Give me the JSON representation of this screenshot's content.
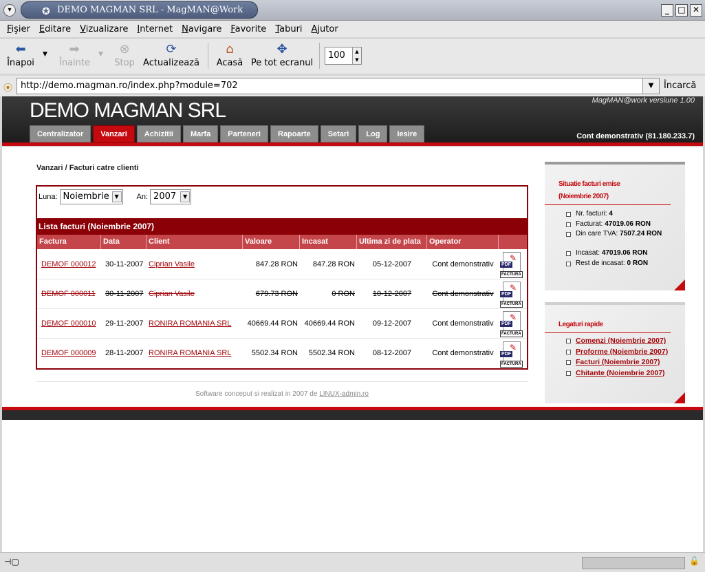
{
  "window": {
    "title": "DEMO MAGMAN SRL - MagMAN@Work"
  },
  "menu": [
    "Fişier",
    "Editare",
    "Vizualizare",
    "Internet",
    "Navigare",
    "Favorite",
    "Taburi",
    "Ajutor"
  ],
  "toolbar": {
    "back": "Înapoi",
    "forward": "Înainte",
    "stop": "Stop",
    "reload": "Actualizează",
    "home": "Acasă",
    "fullscreen": "Pe tot ecranul",
    "zoom": "100"
  },
  "address": {
    "url": "http://demo.magman.ro/index.php?module=702",
    "go": "Încarcă"
  },
  "header": {
    "logo": "DEMO MAGMAN SRL",
    "version": "MagMAN@work versiune 1.00",
    "account": "Cont demonstrativ (81.180.233.7)"
  },
  "tabs": [
    "Centralizator",
    "Vanzari",
    "Achizitii",
    "Marfa",
    "Parteneri",
    "Rapoarte",
    "Setari",
    "Log",
    "Iesire"
  ],
  "active_tab": "Vanzari",
  "breadcrumb": "Vanzari / Facturi catre clienti",
  "filters": {
    "month_label": "Luna:",
    "month_value": "Noiembrie",
    "year_label": "An:",
    "year_value": "2007"
  },
  "list": {
    "title": "Lista facturi (Noiembrie 2007)",
    "columns": [
      "Factura",
      "Data",
      "Client",
      "Valoare",
      "Incasat",
      "Ultima zi de plata",
      "Operator",
      ""
    ],
    "rows": [
      {
        "factura": "DEMOF 000012",
        "data": "30-11-2007",
        "client": "Ciprian Vasile",
        "valoare": "847.28 RON",
        "incasat": "847.28 RON",
        "ultima": "05-12-2007",
        "operator": "Cont demonstrativ",
        "cancelled": false
      },
      {
        "factura": "DEMOF 000011",
        "data": "30-11-2007",
        "client": "Ciprian Vasile",
        "valoare": "679.73 RON",
        "incasat": "0 RON",
        "ultima": "10-12-2007",
        "operator": "Cont demonstrativ",
        "cancelled": true
      },
      {
        "factura": "DEMOF 000010",
        "data": "29-11-2007",
        "client": "RONIRA ROMANIA SRL",
        "valoare": "40669.44 RON",
        "incasat": "40669.44 RON",
        "ultima": "09-12-2007",
        "operator": "Cont demonstrativ",
        "cancelled": false
      },
      {
        "factura": "DEMOF 000009",
        "data": "28-11-2007",
        "client": "RONIRA ROMANIA SRL",
        "valoare": "5502.34 RON",
        "incasat": "5502.34 RON",
        "ultima": "08-12-2007",
        "operator": "Cont demonstrativ",
        "cancelled": false
      }
    ],
    "pdf_text": "PDF",
    "pdf_label": "FACTURA"
  },
  "footer": {
    "text": "Software conceput si realizat in 2007 de ",
    "link": "LINUX-admin.ro"
  },
  "situatie": {
    "title_line1": "Situatie facturi emise",
    "title_line2": "(Noiembrie 2007)",
    "items": [
      {
        "label": "Nr. facturi: ",
        "value": "4"
      },
      {
        "label": "Facturat: ",
        "value": "47019.06 RON"
      },
      {
        "label": "Din care TVA: ",
        "value": "7507.24 RON"
      },
      {
        "label": "Incasat: ",
        "value": "47019.06 RON"
      },
      {
        "label": "Rest de incasat: ",
        "value": "0 RON"
      }
    ]
  },
  "legaturi": {
    "title": "Legaturi rapide",
    "links": [
      "Comenzi (Noiembrie 2007)",
      "Proforme (Noiembrie 2007)",
      "Facturi (Noiembrie 2007)",
      "Chitante (Noiembrie 2007)"
    ]
  },
  "colors": {
    "brand_red": "#c4090f",
    "dark_red": "#8a0006",
    "header_dark": "#2a2a2a"
  }
}
